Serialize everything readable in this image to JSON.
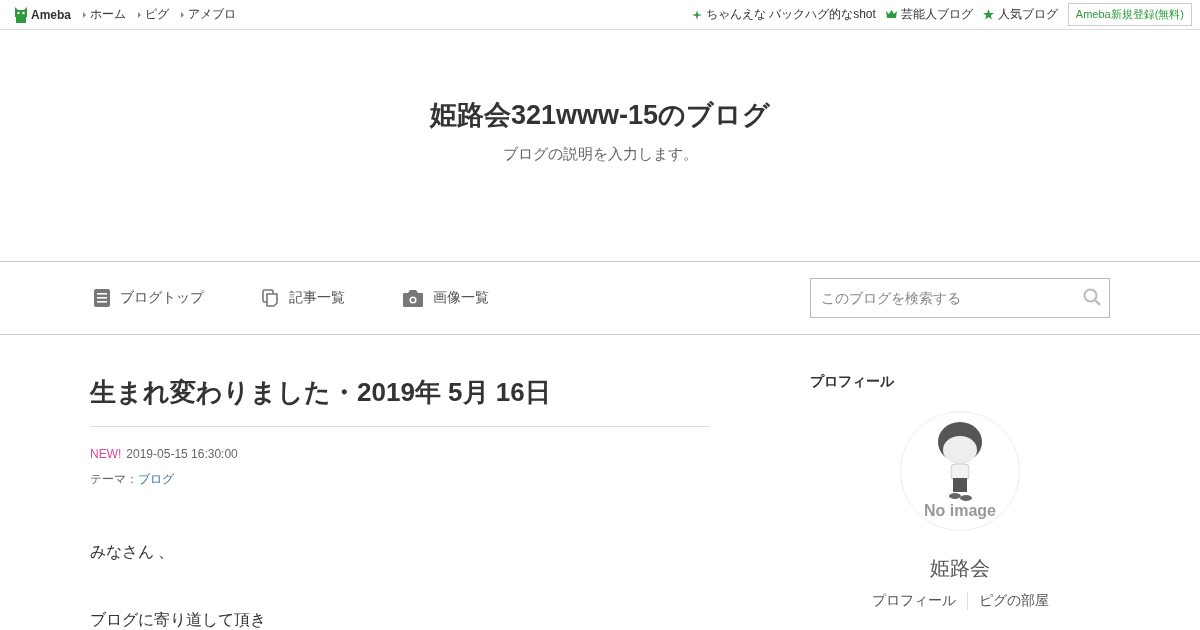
{
  "topbar": {
    "logo": "Ameba",
    "links": [
      "ホーム",
      "ピグ",
      "アメブロ"
    ],
    "right_links": [
      {
        "kind": "sparkle",
        "label": "ちゃんえな バックハグ的なshot"
      },
      {
        "kind": "crown",
        "label": "芸能人ブログ"
      },
      {
        "kind": "star",
        "label": "人気ブログ"
      }
    ],
    "signup": "Ameba新規登録(無料)"
  },
  "header": {
    "title": "姫路会321www-15のブログ",
    "description": "ブログの説明を入力します。"
  },
  "nav": {
    "items": [
      {
        "kind": "doc",
        "label": "ブログトップ"
      },
      {
        "kind": "pages",
        "label": "記事一覧"
      },
      {
        "kind": "camera",
        "label": "画像一覧"
      }
    ],
    "search": {
      "placeholder": "このブログを検索する"
    }
  },
  "article": {
    "title": "生まれ変わりました・2019年 5月 16日",
    "new_badge": "NEW!",
    "date": "2019-05-15 16:30:00",
    "theme_label": "テーマ：",
    "theme": "ブログ",
    "paragraphs": [
      "みなさん 、",
      "ブログに寄り道して頂き"
    ]
  },
  "sidebar": {
    "heading": "プロフィール",
    "avatar_text": "No image",
    "name": "姫路会",
    "links": [
      "プロフィール",
      "ピグの部屋"
    ]
  }
}
